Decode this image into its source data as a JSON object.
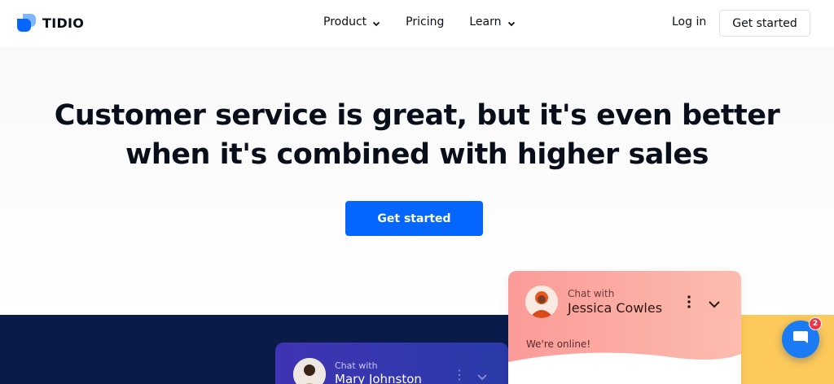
{
  "header": {
    "logo_text": "TIDIO",
    "nav": [
      {
        "label": "Product",
        "has_dropdown": true
      },
      {
        "label": "Pricing",
        "has_dropdown": false
      },
      {
        "label": "Learn",
        "has_dropdown": true
      }
    ],
    "login_label": "Log in",
    "get_started_label": "Get started"
  },
  "hero": {
    "headline_part1": "Customer service is great, but it's ",
    "headline_bold": "even better",
    "headline_part2": "when it's combined with higher sales",
    "cta_label": "Get started"
  },
  "chat_widget": {
    "chat_with_label": "Chat with",
    "agent_name": "Jessica Cowles",
    "status_text": "We're online!"
  },
  "chat_widget_secondary": {
    "chat_with_label": "Chat with",
    "agent_name": "Mary Johnston"
  },
  "launcher": {
    "badge_count": "2"
  },
  "colors": {
    "brand_blue": "#0566ff",
    "dark_band": "#0a1b4a",
    "widget_pink": "#fb9b98",
    "accent_yellow": "#fcc95a",
    "badge_red": "#e8374a"
  },
  "icons": [
    "tidio-logo-icon",
    "chevron-down-icon",
    "kebab-menu-icon",
    "chat-bubble-icon"
  ]
}
